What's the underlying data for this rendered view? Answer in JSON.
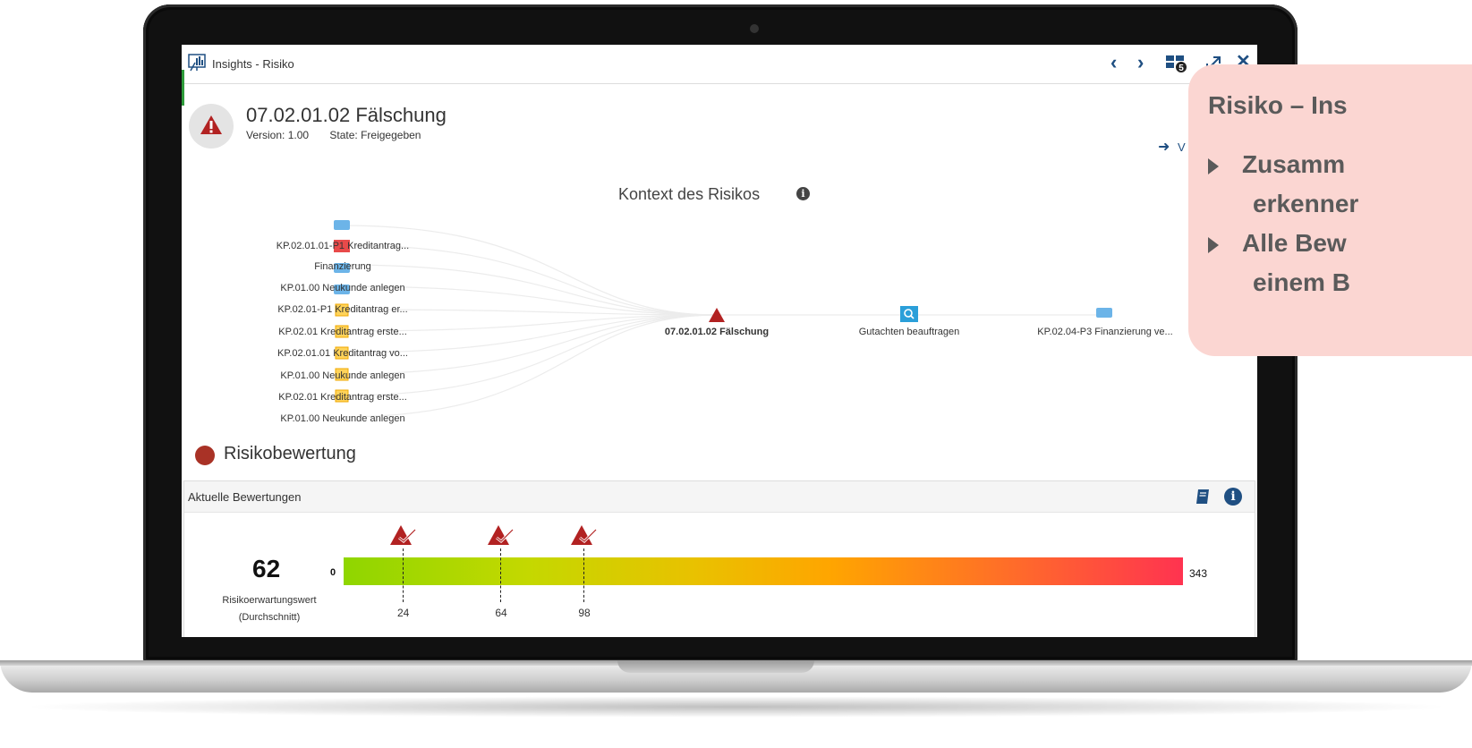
{
  "window": {
    "title": "Insights - Risiko",
    "nav_prev": "‹",
    "nav_next": "›",
    "tiles_badge": "5",
    "close": "✕"
  },
  "risk": {
    "name": "07.02.01.02 Fälschung",
    "version": "Version: 1.00",
    "state": "State: Freigegeben",
    "goto_label": "V"
  },
  "context": {
    "title": "Kontext des Risikos",
    "left_nodes": [
      "KP.02.01.01-P1 Kreditantrag...",
      "Finanzierung",
      "KP.01.00 Neukunde anlegen",
      "KP.02.01-P1 Kreditantrag er...",
      "KP.02.01 Kreditantrag erste...",
      "KP.02.01.01 Kreditantrag vo...",
      "KP.01.00 Neukunde anlegen",
      "KP.02.01 Kreditantrag erste...",
      "KP.01.00 Neukunde anlegen"
    ],
    "center_node": "07.02.01.02 Fälschung",
    "mid_node": "Gutachten beauftragen",
    "right_node": "KP.02.04-P3 Finanzierung ve..."
  },
  "assessment": {
    "section_title": "Risikobewertung",
    "panel_title": "Aktuelle Bewertungen",
    "value": "62",
    "value_label_1": "Risikoerwartungswert",
    "value_label_2": "(Durchschnitt)",
    "scale_min": "0",
    "scale_max": "343",
    "scale_min_value": 0,
    "scale_max_value": 343,
    "markers": [
      {
        "value": 24,
        "label": "24"
      },
      {
        "value": 64,
        "label": "64"
      },
      {
        "value": 98,
        "label": "98"
      }
    ]
  },
  "callout": {
    "title": "Risiko – Ins",
    "bullet1_line1": "Zusamm",
    "bullet1_line2": "erkenner",
    "bullet2_line1": "Alle Bew",
    "bullet2_line2": "einem B"
  },
  "colors": {
    "accent": "#1f4f82",
    "risk_red": "#b22222",
    "callout_bg": "#fbd6d2"
  }
}
